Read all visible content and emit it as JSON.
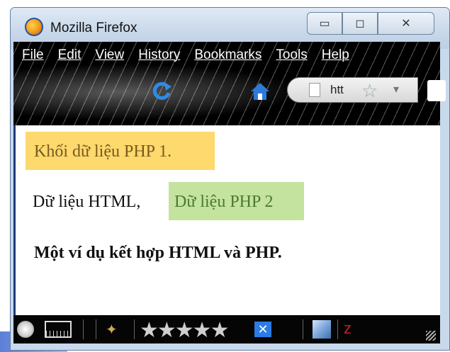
{
  "window": {
    "title": "Mozilla Firefox",
    "buttons": [
      "minimize",
      "maximize",
      "close"
    ]
  },
  "menu": [
    "File",
    "Edit",
    "View",
    "History",
    "Bookmarks",
    "Tools",
    "Help"
  ],
  "toolbar": {
    "url_text": "htt"
  },
  "content": {
    "php1": "Khối dữ liệu PHP 1.",
    "html_text": "Dữ liệu HTML,",
    "php2": "Dữ liệu PHP 2",
    "bold_text": "Một ví dụ kết hợp HTML và PHP."
  },
  "status": {
    "rating_stars": "★★★★★"
  },
  "colors": {
    "php1_bg": "#fdd96e",
    "php2_bg": "#c3e39f",
    "chrome": "#111111"
  }
}
